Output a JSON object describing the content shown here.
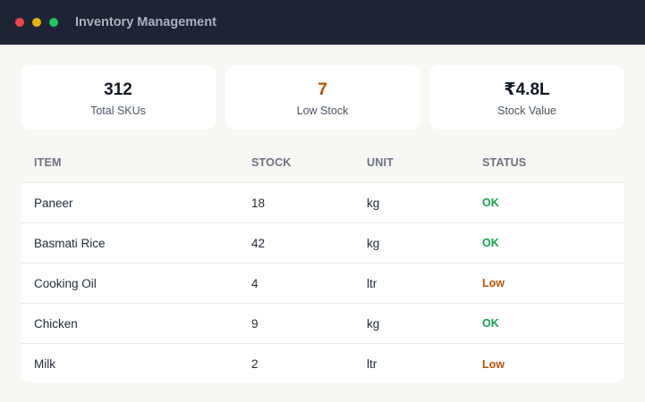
{
  "window": {
    "title": "Inventory Management",
    "controls": [
      {
        "name": "close",
        "color": "#ef4444"
      },
      {
        "name": "minimize",
        "color": "#eab308"
      },
      {
        "name": "maximize",
        "color": "#22c55e"
      }
    ]
  },
  "stats": [
    {
      "value": "312",
      "label": "Total SKUs",
      "color": "#111827"
    },
    {
      "value": "7",
      "label": "Low Stock",
      "color": "#b45309"
    },
    {
      "value": "₹4.8L",
      "label": "Stock Value",
      "color": "#111827"
    }
  ],
  "table": {
    "headers": {
      "item": "ITEM",
      "stock": "STOCK",
      "unit": "UNIT",
      "status": "STATUS"
    },
    "rows": [
      {
        "item": "Paneer",
        "stock": "18",
        "unit": "kg",
        "status": "OK"
      },
      {
        "item": "Basmati Rice",
        "stock": "42",
        "unit": "kg",
        "status": "OK"
      },
      {
        "item": "Cooking Oil",
        "stock": "4",
        "unit": "ltr",
        "status": "Low"
      },
      {
        "item": "Chicken",
        "stock": "9",
        "unit": "kg",
        "status": "OK"
      },
      {
        "item": "Milk",
        "stock": "2",
        "unit": "ltr",
        "status": "Low"
      }
    ]
  },
  "colors": {
    "titlebar": "#1e2436",
    "background": "#f8f7f3",
    "status_ok": "#16a34a",
    "status_low": "#b45309"
  }
}
